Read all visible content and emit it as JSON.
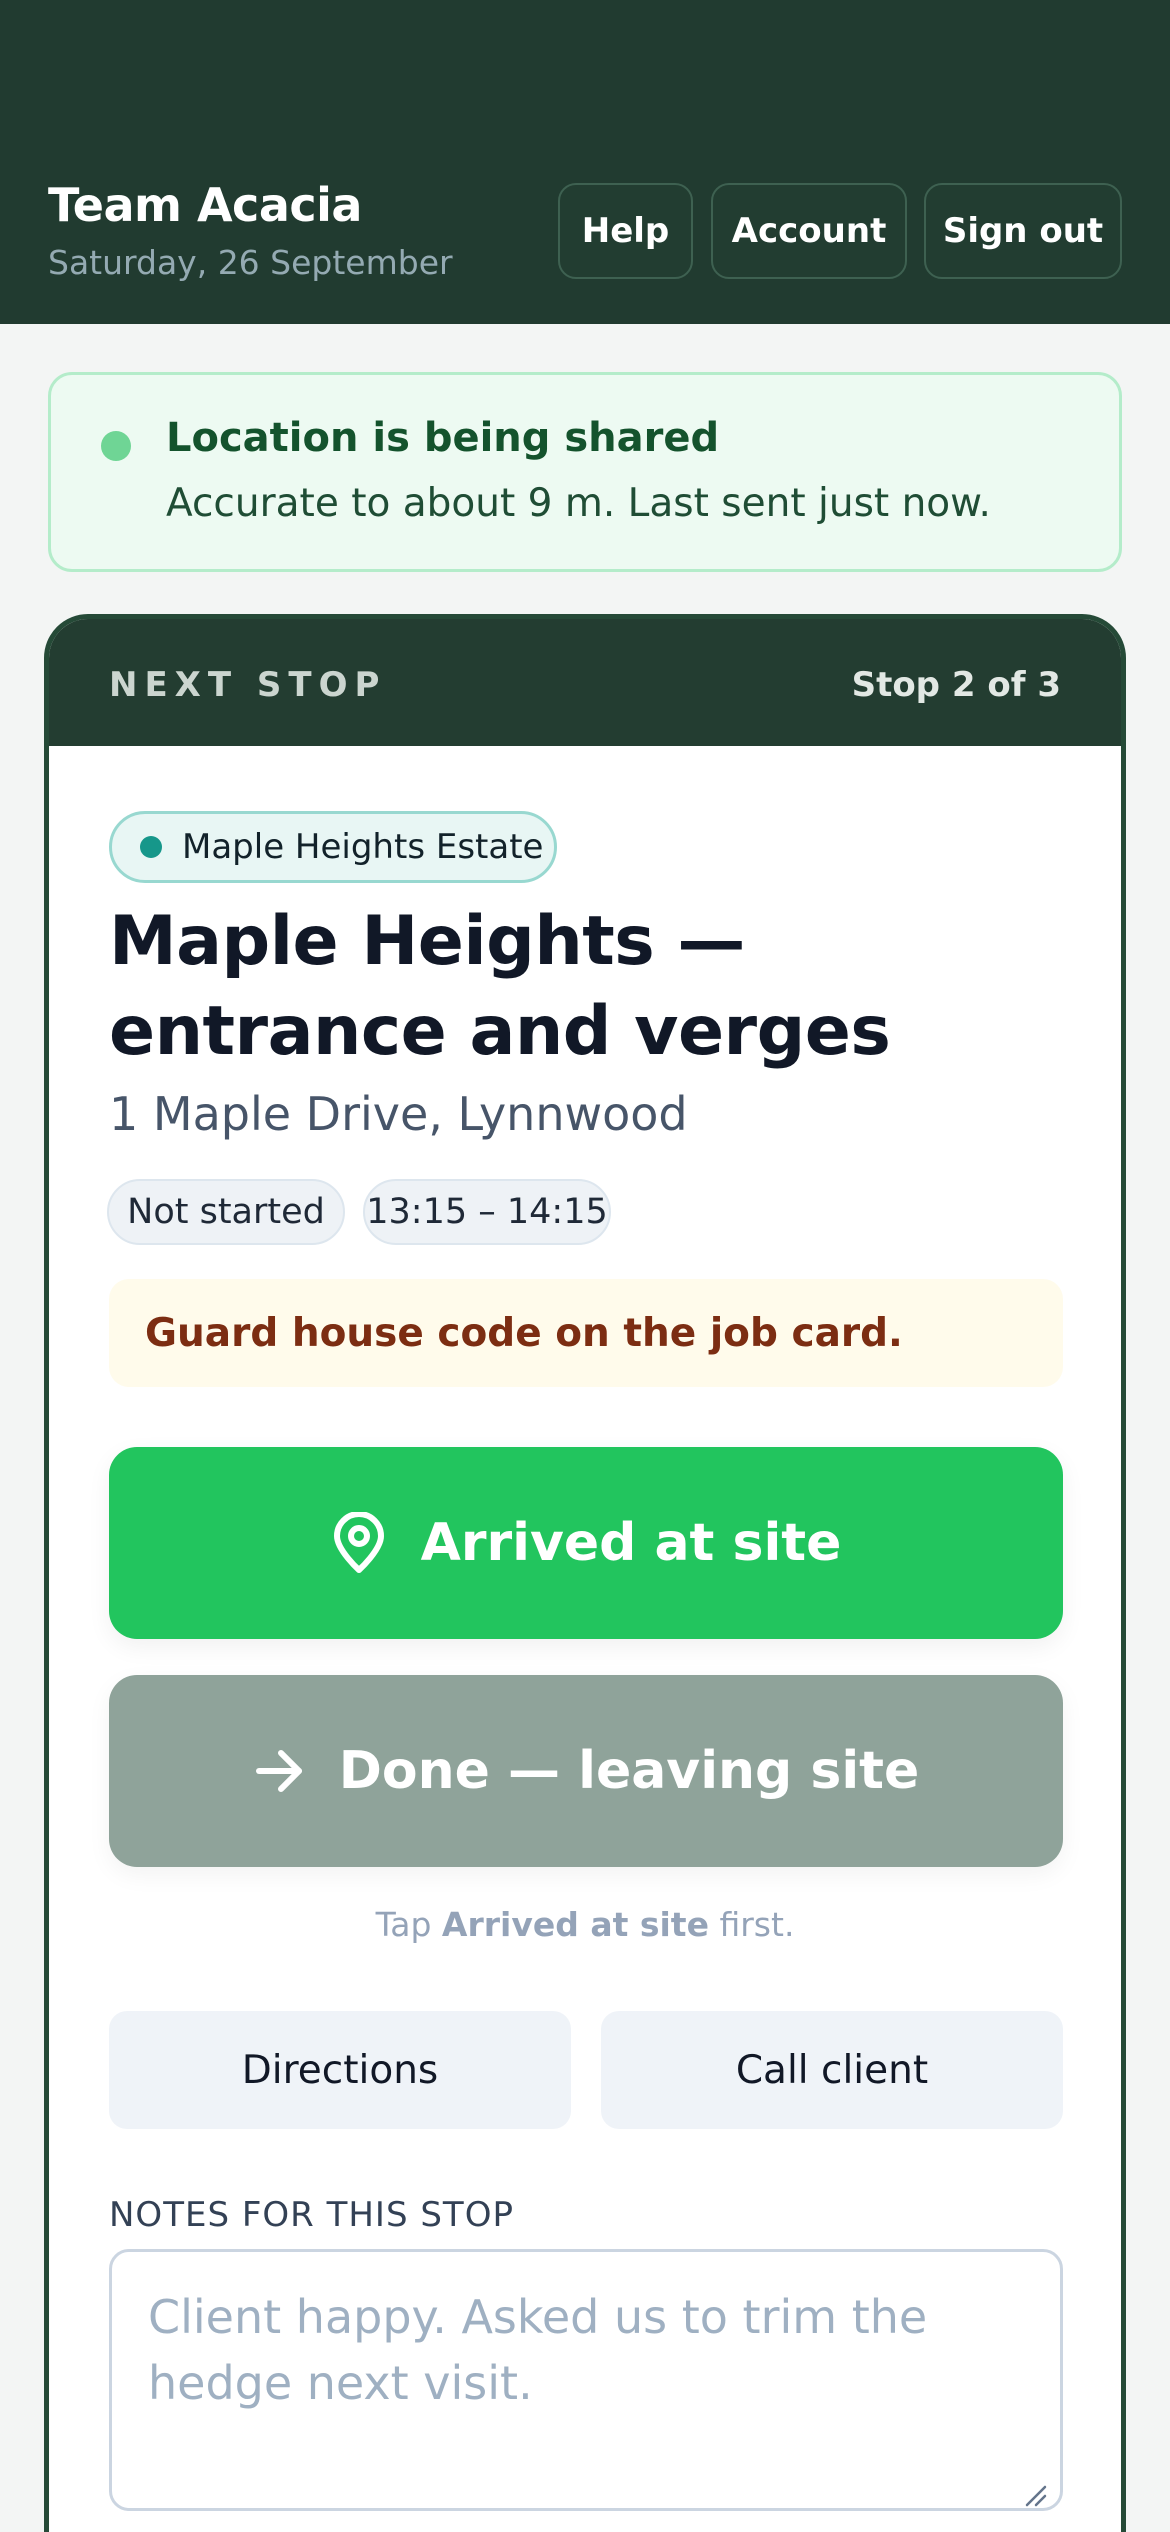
{
  "header": {
    "team_name": "Team Acacia",
    "date": "Saturday, 26 September",
    "help_label": "Help",
    "account_label": "Account",
    "signout_label": "Sign out"
  },
  "location": {
    "title": "Location is being shared",
    "subtitle": "Accurate to about 9 m. Last sent just now.",
    "status_color": "#6fd595"
  },
  "stop": {
    "section_label": "NEXT STOP",
    "progress": "Stop 2 of 3",
    "estate": "Maple Heights Estate",
    "title": "Maple Heights — entrance and verges",
    "address": "1 Maple Drive, Lynnwood",
    "status": "Not started",
    "time_window": "13:15 – 14:15",
    "note": "Guard house code on the job card.",
    "arrived_label": "Arrived at site",
    "done_label": "Done — leaving site",
    "hint_prefix": "Tap ",
    "hint_emphasis": "Arrived at site",
    "hint_suffix": " first.",
    "directions_label": "Directions",
    "call_label": "Call client",
    "notes_label": "NOTES FOR THIS STOP",
    "notes_placeholder": "Client happy. Asked us to trim the hedge next visit.",
    "notes_value": ""
  },
  "colors": {
    "header_bg": "#213b30",
    "primary_action": "#22c55e",
    "disabled_action": "#8fa39a"
  }
}
